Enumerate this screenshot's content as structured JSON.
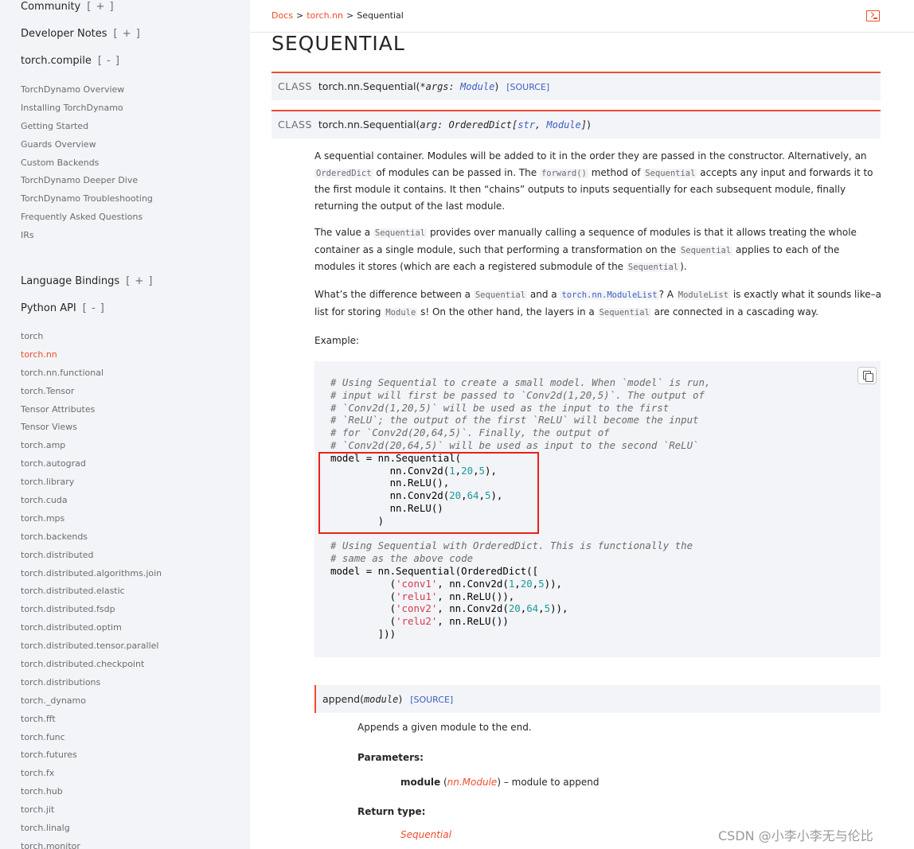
{
  "sidebar": {
    "sections_top": [
      {
        "label": "Community",
        "toggle": "[ + ]"
      },
      {
        "label": "Developer Notes",
        "toggle": "[ + ]"
      },
      {
        "label": "torch.compile",
        "toggle": "[ - ]"
      }
    ],
    "compile_items": [
      "TorchDynamo Overview",
      "Installing TorchDynamo",
      "Getting Started",
      "Guards Overview",
      "Custom Backends",
      "TorchDynamo Deeper Dive",
      "TorchDynamo Troubleshooting",
      "Frequently Asked Questions",
      "IRs"
    ],
    "sections_mid": [
      {
        "label": "Language Bindings",
        "toggle": "[ + ]"
      },
      {
        "label": "Python API",
        "toggle": "[ - ]"
      }
    ],
    "api_items": [
      "torch",
      "torch.nn",
      "torch.nn.functional",
      "torch.Tensor",
      "Tensor Attributes",
      "Tensor Views",
      "torch.amp",
      "torch.autograd",
      "torch.library",
      "torch.cuda",
      "torch.mps",
      "torch.backends",
      "torch.distributed",
      "torch.distributed.algorithms.join",
      "torch.distributed.elastic",
      "torch.distributed.fsdp",
      "torch.distributed.optim",
      "torch.distributed.tensor.parallel",
      "torch.distributed.checkpoint",
      "torch.distributions",
      "torch._dynamo",
      "torch.fft",
      "torch.func",
      "torch.futures",
      "torch.fx",
      "torch.hub",
      "torch.jit",
      "torch.linalg",
      "torch.monitor"
    ],
    "active_item": "torch.nn"
  },
  "breadcrumb": {
    "docs": "Docs",
    "sep": ">",
    "section": "torch.nn",
    "current": "Sequential"
  },
  "page_title": "SEQUENTIAL",
  "sig1": {
    "kw": "CLASS",
    "name": "torch.nn.Sequential(",
    "arg": "*args",
    "colon": ": ",
    "type": "Module",
    "close": ")",
    "source": "[SOURCE]"
  },
  "sig2": {
    "kw": "CLASS",
    "name": "torch.nn.Sequential(",
    "arg": "arg",
    "colon": ": ",
    "type_a": "OrderedDict",
    "bracket_open": "[",
    "type_b": "str",
    "comma": ", ",
    "type_c": "Module",
    "bracket_close": "]",
    "close": ")"
  },
  "para1": {
    "t1": "A sequential container. Modules will be added to it in the order they are passed in the constructor. Alternatively, an ",
    "c1": "OrderedDict",
    "t2": " of modules can be passed in. The ",
    "c2": "forward()",
    "t3": " method of ",
    "c3": "Sequential",
    "t4": " accepts any input and forwards it to the first module it contains. It then “chains” outputs to inputs sequentially for each subsequent module, finally returning the output of the last module."
  },
  "para2": {
    "t1": "The value a ",
    "c1": "Sequential",
    "t2": " provides over manually calling a sequence of modules is that it allows treating the whole container as a single module, such that performing a transformation on the ",
    "c2": "Sequential",
    "t3": " applies to each of the modules it stores (which are each a registered submodule of the ",
    "c3": "Sequential",
    "t4": ")."
  },
  "para3": {
    "t1": "What’s the difference between a ",
    "c1": "Sequential",
    "t2": " and a ",
    "c2": "torch.nn.ModuleList",
    "t3": "? A ",
    "c3": "ModuleList",
    "t4": " is exactly what it sounds like–a list for storing ",
    "c4": "Module",
    "t5": " s! On the other hand, the layers in a ",
    "c5": "Sequential",
    "t6": " are connected in a cascading way."
  },
  "example_label": "Example:",
  "code": {
    "comment1": [
      "# Using Sequential to create a small model. When `model` is run,",
      "# input will first be passed to `Conv2d(1,20,5)`. The output of",
      "# `Conv2d(1,20,5)` will be used as the input to the first",
      "# `ReLU`; the output of the first `ReLU` will become the input",
      "# for `Conv2d(20,64,5)`. Finally, the output of",
      "# `Conv2d(20,64,5)` will be used as input to the second `ReLU`"
    ],
    "comment2": [
      "# Using Sequential with OrderedDict. This is functionally the",
      "# same as the above code"
    ]
  },
  "method": {
    "name": "append(",
    "arg": "module",
    "close": ")",
    "source": "[SOURCE]"
  },
  "method_desc": "Appends a given module to the end.",
  "params_heading": "Parameters:",
  "param": {
    "name": "module",
    "open": " (",
    "type": "nn.Module",
    "close": ")",
    "desc": " – module to append"
  },
  "return_heading": "Return type:",
  "return_type": "Sequential",
  "watermark": "CSDN @小李小李无与伦比"
}
